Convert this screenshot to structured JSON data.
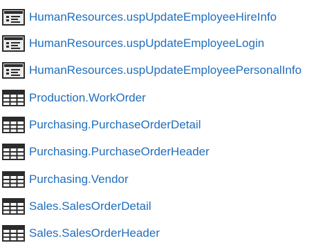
{
  "colors": {
    "link": "#1f6ebd",
    "icon_stroke": "#2b2b2b",
    "procedure_icon_fill": "#ececec",
    "table_icon_fill": "#ffffff"
  },
  "objects": [
    {
      "icon": "stored-procedure-icon",
      "label": "HumanResources.uspUpdateEmployeeHireInfo"
    },
    {
      "icon": "stored-procedure-icon",
      "label": "HumanResources.uspUpdateEmployeeLogin"
    },
    {
      "icon": "stored-procedure-icon",
      "label": "HumanResources.uspUpdateEmployeePersonalInfo"
    },
    {
      "icon": "table-icon",
      "label": "Production.WorkOrder"
    },
    {
      "icon": "table-icon",
      "label": "Purchasing.PurchaseOrderDetail"
    },
    {
      "icon": "table-icon",
      "label": "Purchasing.PurchaseOrderHeader"
    },
    {
      "icon": "table-icon",
      "label": "Purchasing.Vendor"
    },
    {
      "icon": "table-icon",
      "label": "Sales.SalesOrderDetail"
    },
    {
      "icon": "table-icon",
      "label": "Sales.SalesOrderHeader"
    }
  ]
}
